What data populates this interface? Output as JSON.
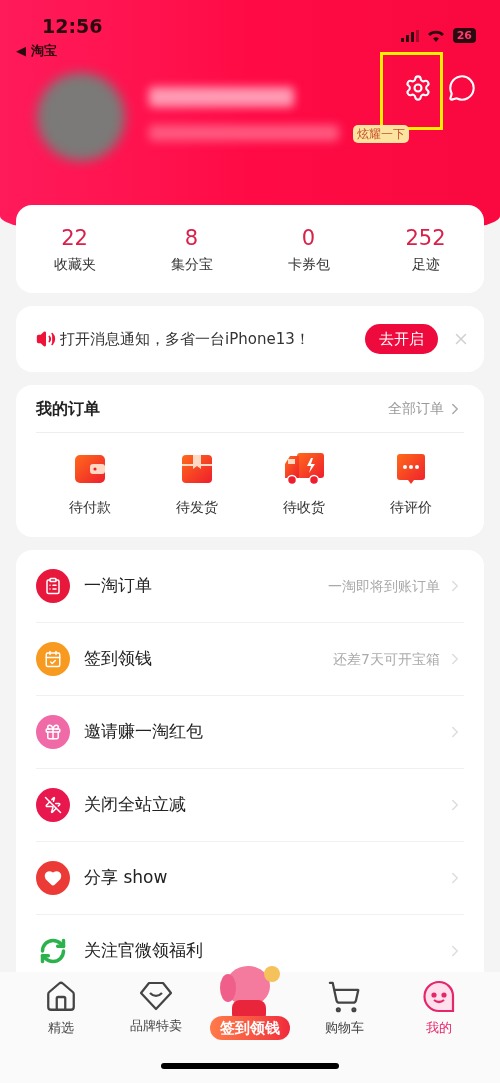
{
  "status_bar": {
    "time": "12:56",
    "battery": "26",
    "back_label": "◀ 淘宝"
  },
  "profile": {
    "badge": "炫耀一下"
  },
  "stats": [
    {
      "value": "22",
      "label": "收藏夹"
    },
    {
      "value": "8",
      "label": "集分宝"
    },
    {
      "value": "0",
      "label": "卡券包"
    },
    {
      "value": "252",
      "label": "足迹"
    }
  ],
  "notice": {
    "text": "打开消息通知，多省一台iPhone13！",
    "button": "去开启"
  },
  "orders": {
    "title": "我的订单",
    "link": "全部订单",
    "items": [
      {
        "label": "待付款",
        "kind": "wallet"
      },
      {
        "label": "待发货",
        "kind": "box"
      },
      {
        "label": "待收货",
        "kind": "truck"
      },
      {
        "label": "待评价",
        "kind": "review"
      }
    ]
  },
  "menu": [
    {
      "label": "一淘订单",
      "hint": "一淘即将到账订单",
      "kind": "clipboard"
    },
    {
      "label": "签到领钱",
      "hint": "还差7天可开宝箱",
      "kind": "calendar"
    },
    {
      "label": "邀请赚一淘红包",
      "kind": "gift"
    },
    {
      "label": "关闭全站立减",
      "kind": "bolt-off"
    },
    {
      "label": "分享 show",
      "kind": "heart"
    },
    {
      "label": "关注官微领福利",
      "kind": "recycle"
    }
  ],
  "tab_bar": [
    {
      "label": "精选",
      "kind": "home",
      "selected": false
    },
    {
      "label": "品牌特卖",
      "kind": "diamond",
      "selected": false
    },
    {
      "label": "签到领钱",
      "kind": "promo",
      "selected": false
    },
    {
      "label": "购物车",
      "kind": "cart",
      "selected": false
    },
    {
      "label": "我的",
      "kind": "me",
      "selected": true
    }
  ]
}
